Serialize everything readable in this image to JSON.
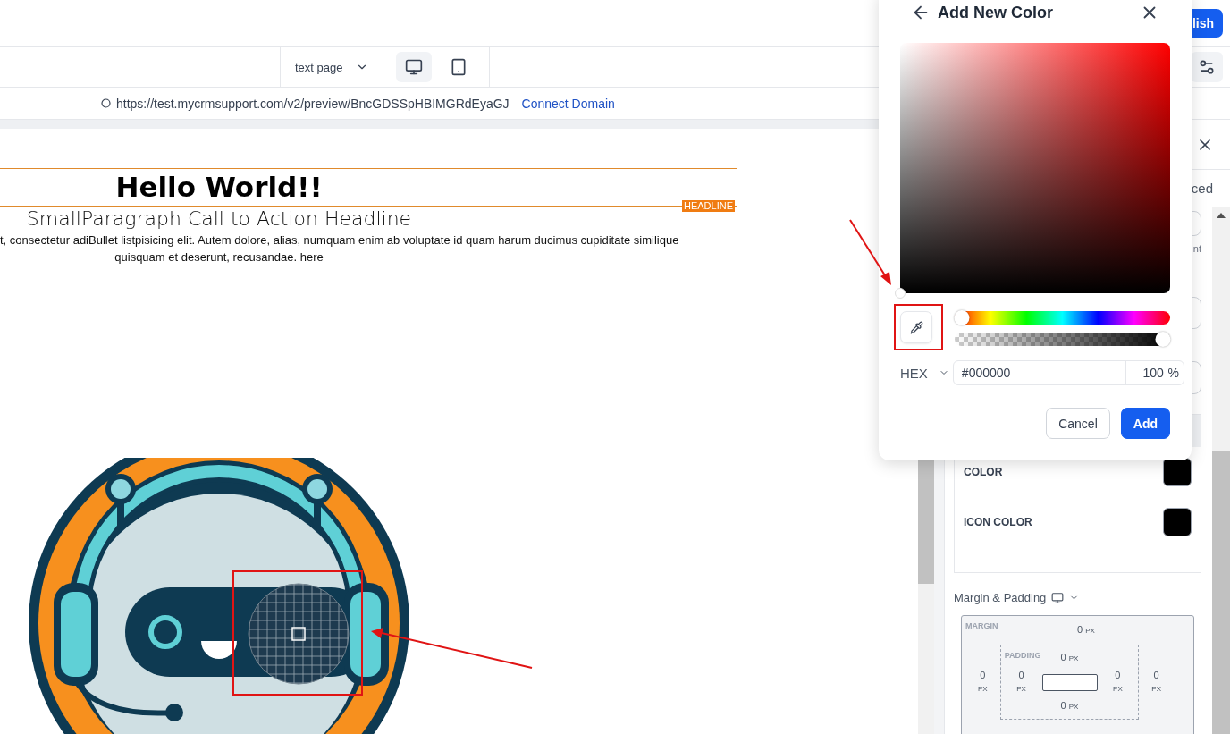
{
  "topbar": {
    "publish_button": "lish"
  },
  "toolbar": {
    "page_select": "text page",
    "devices": [
      {
        "kind": "desktop",
        "selected": true
      },
      {
        "kind": "tablet",
        "selected": false
      }
    ]
  },
  "url_bar": {
    "url": "https://test.mycrmsupport.com/v2/preview/BncGDSSpHBIMGRdEyaGJ",
    "link": "Connect Domain"
  },
  "canvas": {
    "headline": "Hello World!!",
    "headline_tag": "HEADLINE",
    "subheadline": "SmallParagraph Call to Action Headline",
    "paragraph_lines": [
      "t, consectetur adiBullet listpisicing elit. Autem dolore, alias, numquam enim ab voluptate id quam harum ducimus cupiditate similique",
      "quisquam et deserunt, recusandae. here"
    ]
  },
  "panel": {
    "tab": "ced",
    "hint": "nt",
    "color_rows": [
      {
        "label": "COLOR",
        "color": "#000000"
      },
      {
        "label": "ICON COLOR",
        "color": "#000000"
      }
    ],
    "spacing_title": "Margin & Padding",
    "margin": {
      "label": "MARGIN",
      "top": {
        "value": "0",
        "unit": "PX"
      },
      "left": {
        "value": "0",
        "unit": "PX"
      },
      "right": {
        "value": "0",
        "unit": "PX"
      }
    },
    "padding": {
      "label": "PADDING",
      "top": {
        "value": "0",
        "unit": "PX"
      },
      "left": {
        "value": "0",
        "unit": "PX"
      },
      "right": {
        "value": "0",
        "unit": "PX"
      },
      "bottom": {
        "value": "0",
        "unit": "PX"
      }
    }
  },
  "color_picker": {
    "title": "Add New Color",
    "hue": {
      "level": 0
    },
    "alpha": {
      "level": 1
    },
    "format": "HEX",
    "hex": "#000000",
    "opacity": "100",
    "opacity_unit": "%",
    "buttons": [
      {
        "label": "Cancel",
        "kind": "secondary"
      },
      {
        "label": "Add",
        "kind": "primary"
      }
    ]
  }
}
